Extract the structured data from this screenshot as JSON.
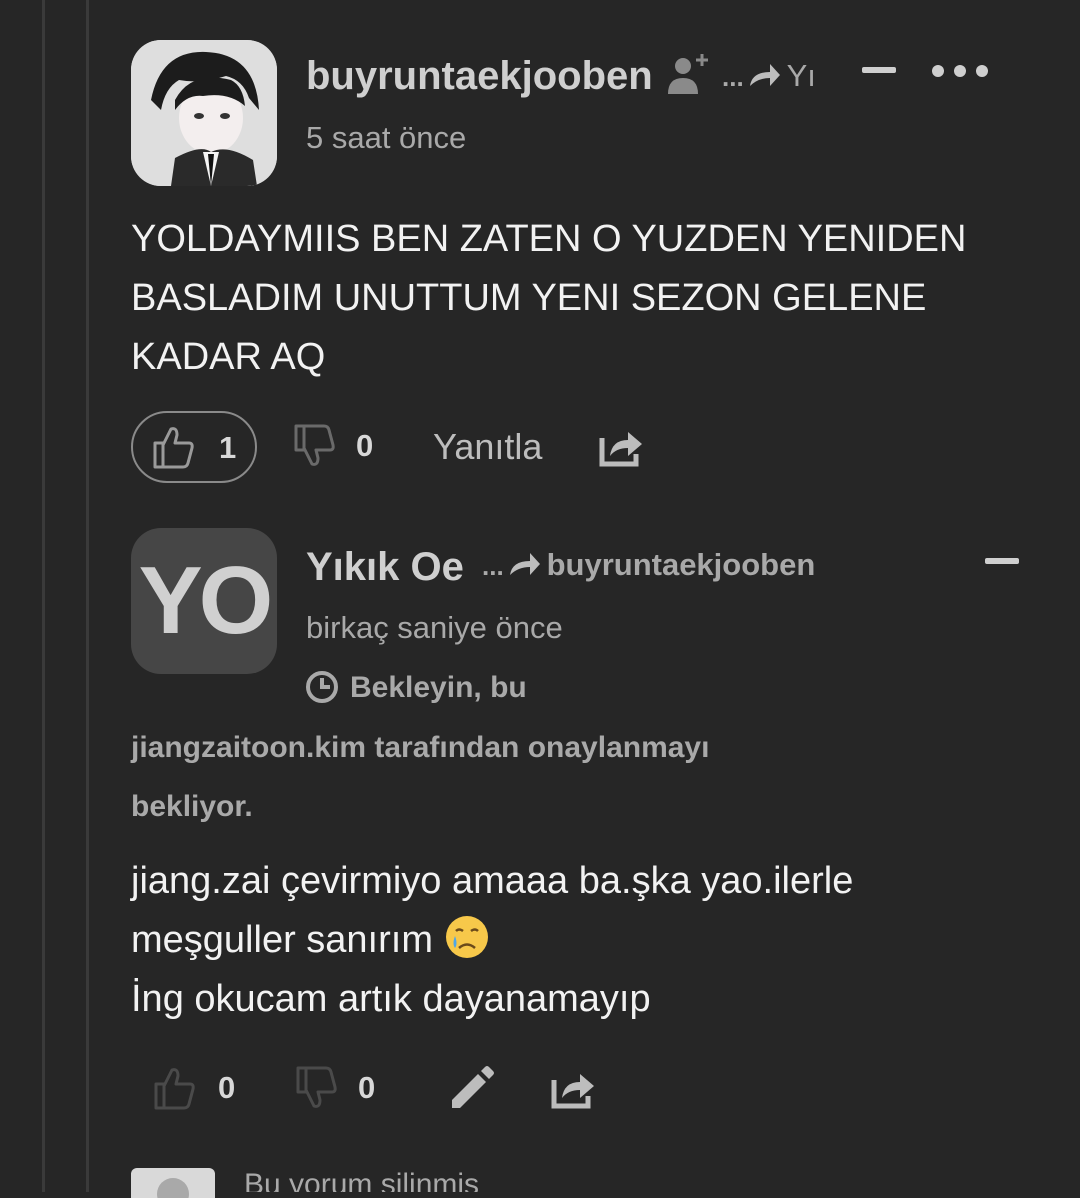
{
  "comment": {
    "author": "buyruntaekjooben",
    "follow_icon": "user-plus-icon",
    "reply_arrow_prefix": "...",
    "reply_to_truncated": "Yı",
    "collapse_icon": "minus-icon",
    "more_icon": "more-dots-icon",
    "time": "5 saat önce",
    "text_lines": [
      "YOLDAYMIIS BEN ZATEN O YUZDEN YENIDEN",
      "BASLADIM UNUTTUM YENI SEZON GELENE",
      "KADAR AQ"
    ],
    "upvotes": "1",
    "downvotes": "0",
    "reply_label": "Yanıtla",
    "share_icon": "share-icon"
  },
  "reply": {
    "avatar_initials": "YO",
    "author": "Yıkık Oe",
    "reply_arrow_prefix": "...",
    "reply_to": "buyruntaekjooben",
    "time": "birkaç saniye önce",
    "pending_line1": "Bekleyin, bu",
    "pending_line2": "jiangzaitoon.kim tarafından onaylanmayı",
    "pending_line3": "bekliyor.",
    "text_line1": "jiang.zai çevirmiyo amaaa ba.şka yao.ilerle",
    "text_line2": "meşguller sanırım",
    "emoji": "😢",
    "text_line3": "İng okucam artık dayanamayıp",
    "upvotes": "0",
    "downvotes": "0",
    "edit_icon": "pencil-icon"
  },
  "deleted": {
    "text": "Bu yorum silinmiş"
  },
  "colors": {
    "background": "#262626",
    "thread_line": "#3a3a3a",
    "text_primary": "#f2f2f2",
    "text_muted": "#a9a9a9"
  }
}
